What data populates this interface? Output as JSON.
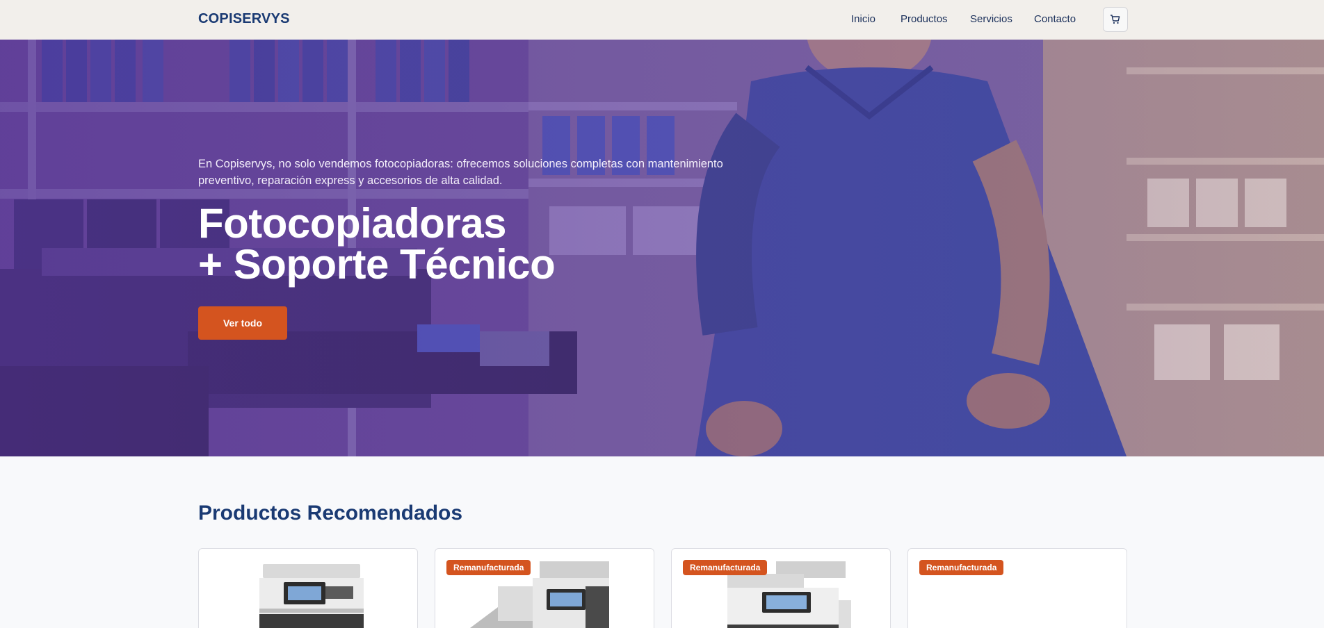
{
  "header": {
    "logo": "COPISERVYS",
    "nav": [
      "Inicio",
      "Productos",
      "Servicios",
      "Contacto"
    ],
    "cart_icon": "cart-icon"
  },
  "hero": {
    "description": "En Copiservys, no solo vendemos fotocopiadoras: ofrecemos soluciones completas con mantenimiento preventivo, reparación express y accesorios de alta calidad.",
    "title_line1": "Fotocopiadoras",
    "title_line2": "+ Soporte Técnico",
    "button": "Ver todo"
  },
  "products": {
    "title": "Productos Recomendados",
    "cards": [
      {
        "badge": ""
      },
      {
        "badge": "Remanufacturada"
      },
      {
        "badge": "Remanufacturada"
      },
      {
        "badge": "Remanufacturada"
      }
    ]
  },
  "colors": {
    "brand": "#1a3a73",
    "accent": "#d4541f",
    "hero_overlay": "#5b3a8e"
  }
}
